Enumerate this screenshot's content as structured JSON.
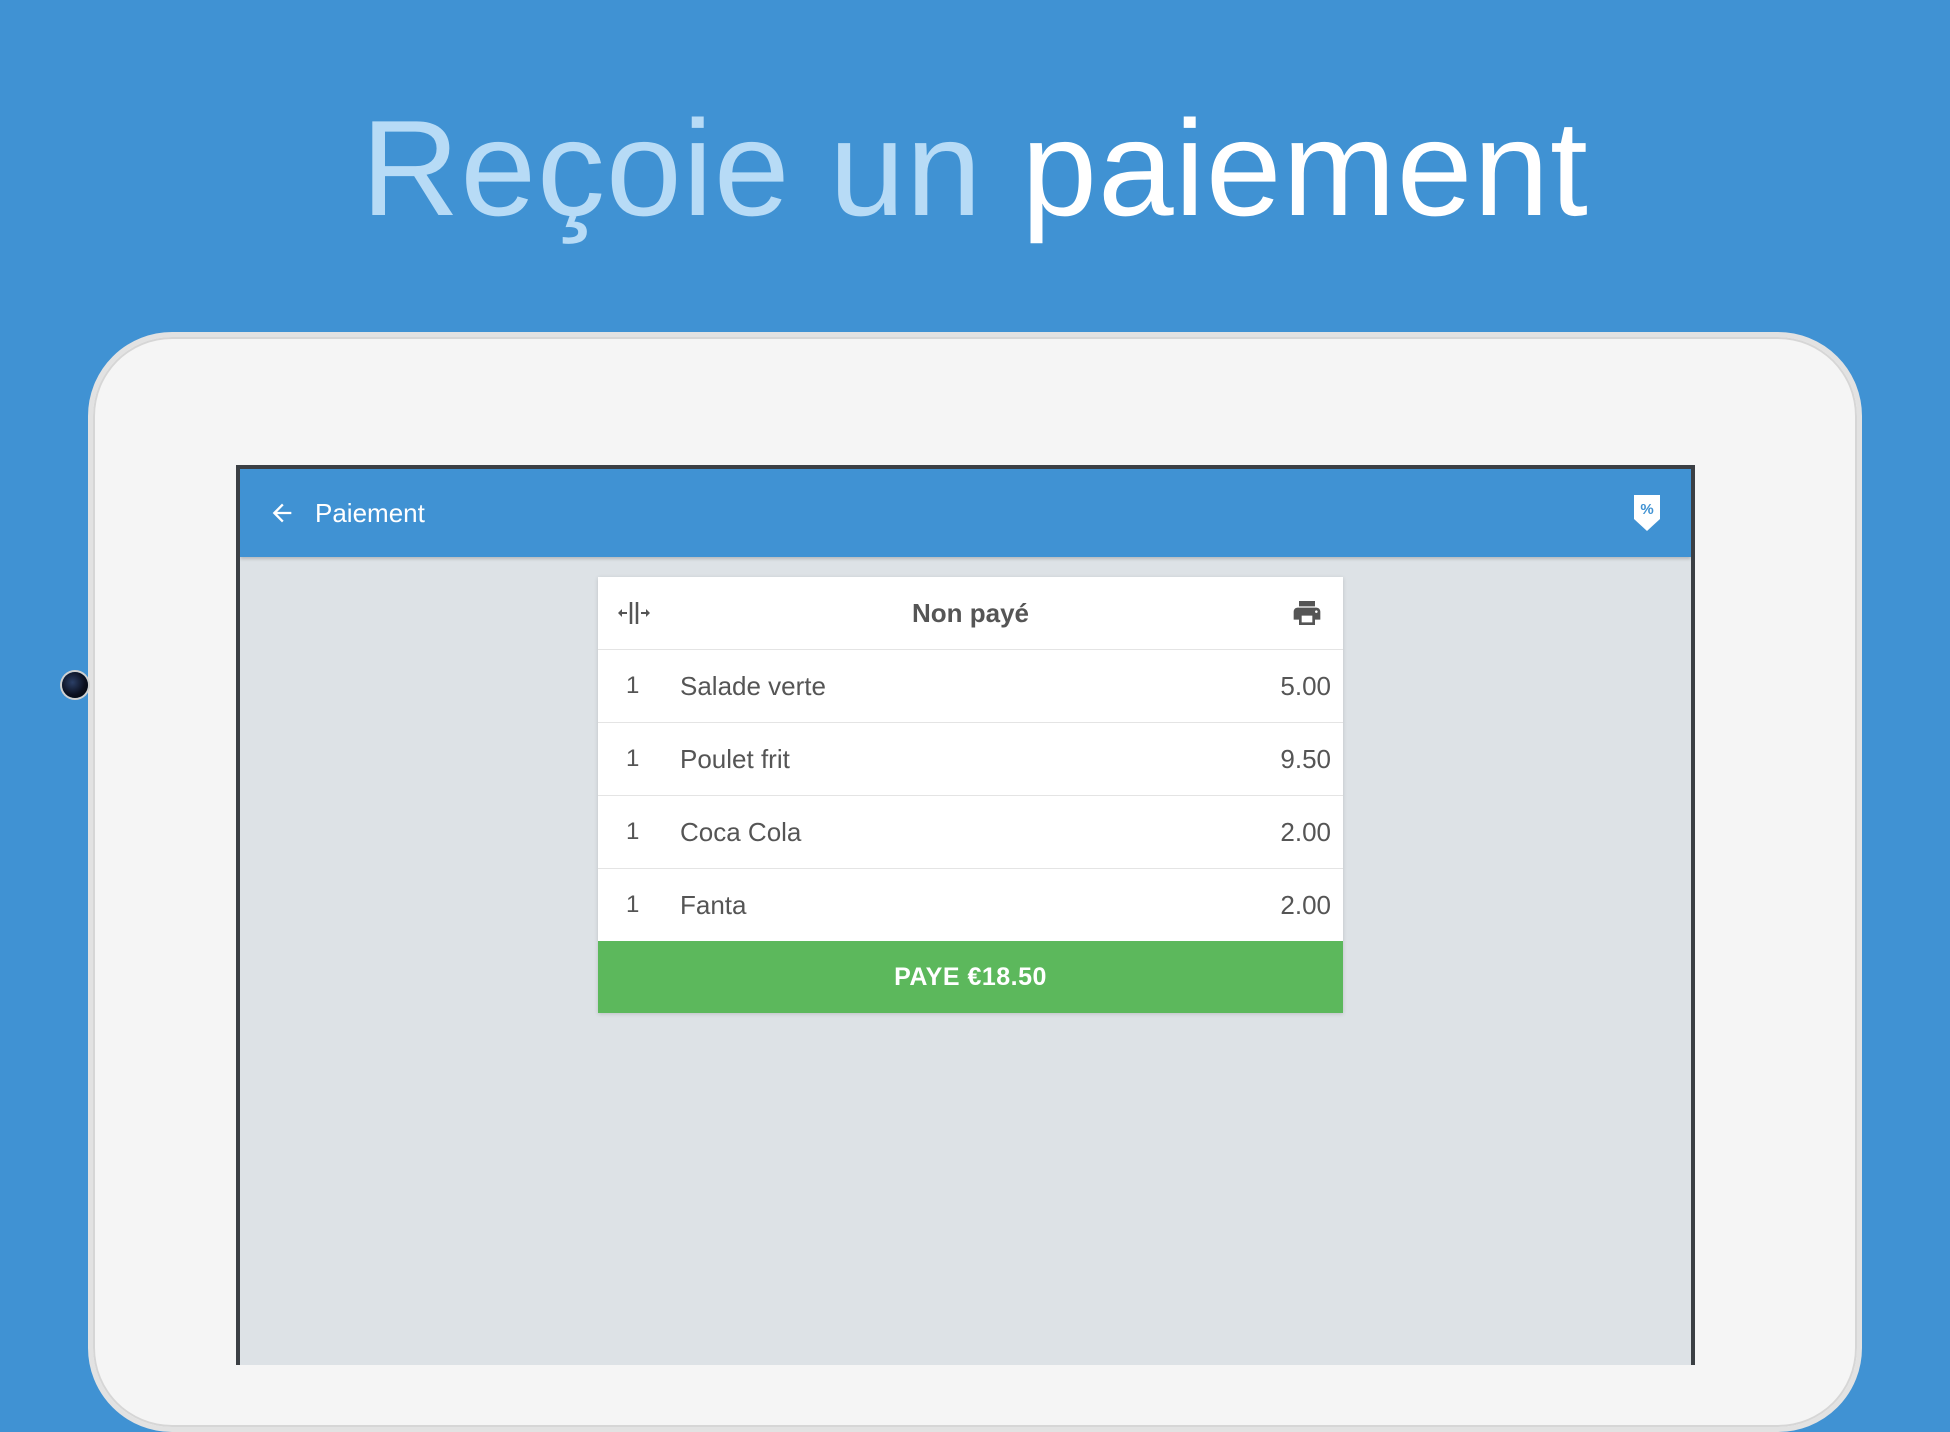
{
  "headline": {
    "light_part": "Reçoie un",
    "strong_part": "paiement"
  },
  "appbar": {
    "title": "Paiement",
    "back_icon": "arrow-left-icon",
    "discount_icon": "percent-tag-icon"
  },
  "bill": {
    "title": "Non payé",
    "split_icon": "split-icon",
    "print_icon": "printer-icon",
    "items": [
      {
        "qty": "1",
        "name": "Salade verte",
        "price": "5.00"
      },
      {
        "qty": "1",
        "name": "Poulet frit",
        "price": "9.50"
      },
      {
        "qty": "1",
        "name": "Coca Cola",
        "price": "2.00"
      },
      {
        "qty": "1",
        "name": "Fanta",
        "price": "2.00"
      }
    ],
    "pay_label": "PAYE €18.50"
  },
  "colors": {
    "background": "#4092d3",
    "appbar": "#4092d3",
    "pay_button": "#5cb85c",
    "screen_bg": "#dde2e6",
    "text": "#555555"
  }
}
